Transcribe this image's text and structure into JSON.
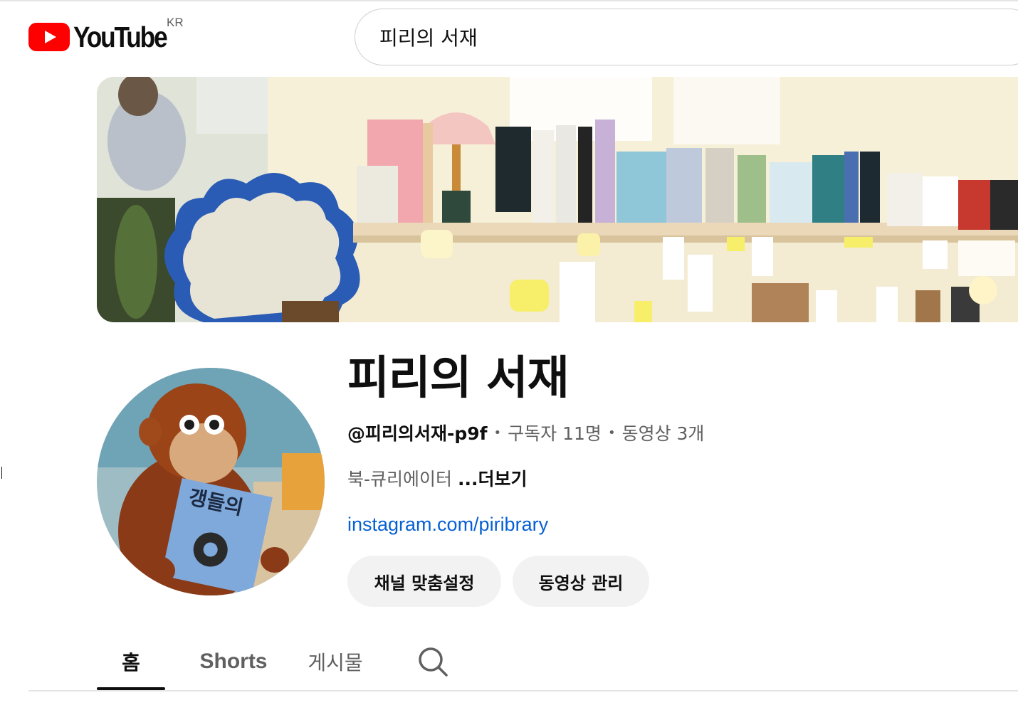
{
  "masthead": {
    "logo_text": "YouTube",
    "country_code": "KR",
    "search": {
      "value": "피리의 서재",
      "icon": "search-icon"
    }
  },
  "channel": {
    "name": "피리의 서재",
    "handle": "@피리의서재-p9f",
    "subscribers": "구독자 11명",
    "videos": "동영상 3개",
    "description": "북-큐리에이터",
    "more_label": "...더보기",
    "link_text": "instagram.com/piribrary",
    "buttons": {
      "customize": "채널 맞춤설정",
      "manage": "동영상 관리"
    },
    "avatar_book_title": "갱들의"
  },
  "tabs": [
    {
      "label": "홈",
      "selected": true
    },
    {
      "label": "Shorts",
      "selected": false
    },
    {
      "label": "게시물",
      "selected": false
    }
  ],
  "colors": {
    "brand_red": "#ff0000",
    "link_blue": "#065fd4",
    "button_bg": "#f2f2f2",
    "secondary_text": "#606060"
  }
}
